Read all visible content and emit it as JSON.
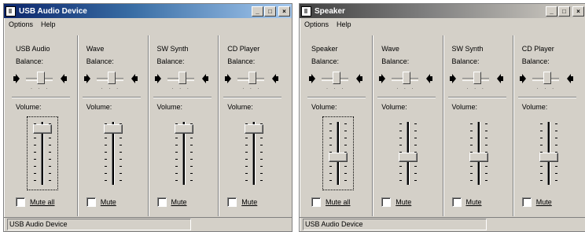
{
  "window1": {
    "title": "USB Audio Device",
    "menu": [
      "Options",
      "Help"
    ],
    "status": "USB Audio Device",
    "panels": [
      {
        "name": "USB Audio",
        "balance_label": "Balance:",
        "volume_label": "Volume:",
        "mute_label": "Mute all",
        "volume_level": 0.9,
        "mute_checked": false
      },
      {
        "name": "Wave",
        "balance_label": "Balance:",
        "volume_label": "Volume:",
        "mute_label": "Mute",
        "volume_level": 0.9,
        "mute_checked": false
      },
      {
        "name": "SW Synth",
        "balance_label": "Balance:",
        "volume_label": "Volume:",
        "mute_label": "Mute",
        "volume_level": 0.9,
        "mute_checked": false
      },
      {
        "name": "CD Player",
        "balance_label": "Balance:",
        "volume_label": "Volume:",
        "mute_label": "Mute",
        "volume_level": 0.9,
        "mute_checked": false
      }
    ]
  },
  "window2": {
    "title": "Speaker",
    "menu": [
      "Options",
      "Help"
    ],
    "status": "USB Audio Device",
    "panels": [
      {
        "name": "Speaker",
        "balance_label": "Balance:",
        "volume_label": "Volume:",
        "mute_label": "Mute all",
        "volume_level": 0.45,
        "mute_checked": false
      },
      {
        "name": "Wave",
        "balance_label": "Balance:",
        "volume_label": "Volume:",
        "mute_label": "Mute",
        "volume_level": 0.45,
        "mute_checked": false
      },
      {
        "name": "SW Synth",
        "balance_label": "Balance:",
        "volume_label": "Volume:",
        "mute_label": "Mute",
        "volume_level": 0.45,
        "mute_checked": false
      },
      {
        "name": "CD Player",
        "balance_label": "Balance:",
        "volume_label": "Volume:",
        "mute_label": "Mute",
        "volume_level": 0.45,
        "mute_checked": false
      }
    ]
  },
  "title_buttons": [
    "minimize",
    "maximize",
    "close"
  ]
}
